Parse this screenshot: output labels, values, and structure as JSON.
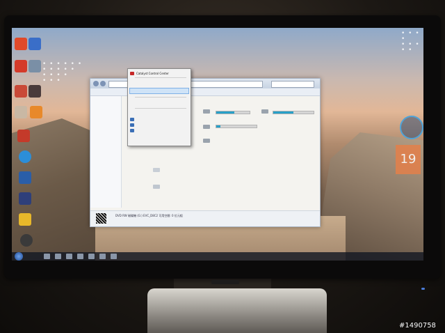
{
  "watermark": "#1490758",
  "context_menu": {
    "title": "Catalyst Control Center"
  },
  "explorer": {
    "status_line": "DVD RW 磁碟機 (G:) EVC_D8C2  可用空間: 0 位元組"
  },
  "gadget": {
    "calendar_day": "19"
  },
  "colors": {
    "drive_fill": "#27a0c8",
    "taskbar": "#141923",
    "menu_highlight": "#cfe3f7"
  },
  "drives": [
    {
      "label": "",
      "fill": 0.55
    },
    {
      "label": "",
      "fill": 0.5
    },
    {
      "label": "",
      "fill": 0.1
    },
    {
      "label": "",
      "fill": 0.1
    }
  ]
}
